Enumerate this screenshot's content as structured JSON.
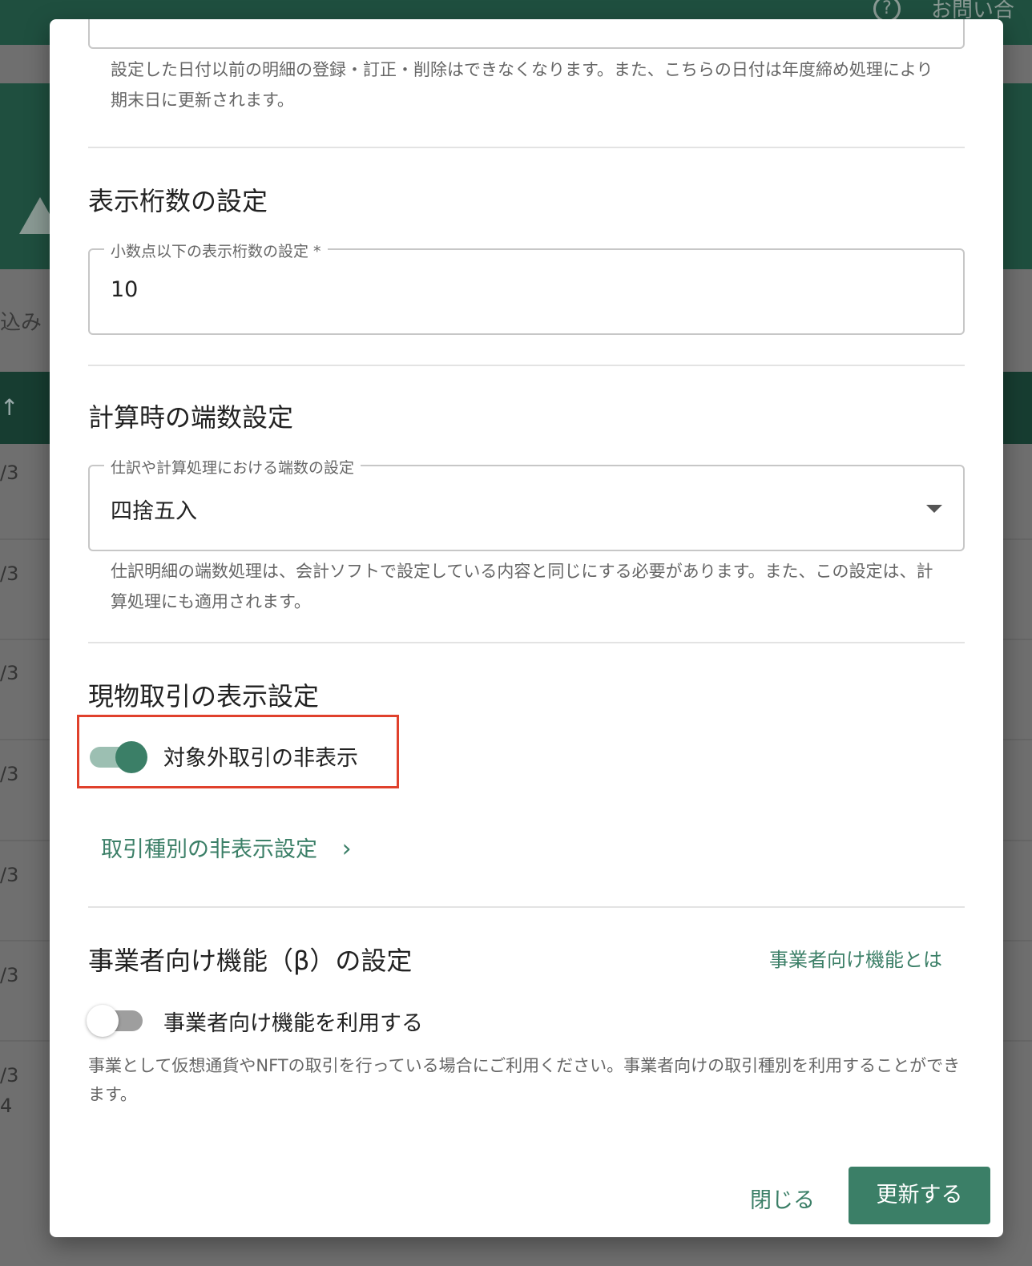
{
  "background": {
    "help_glyph": "?",
    "contact_label": "お問い合わ",
    "tab_label": "込み",
    "sort_arrow": "↑",
    "rows": [
      "/3",
      "/3",
      "/3",
      "/3",
      "/3",
      "/3",
      "/3",
      "4"
    ]
  },
  "modal": {
    "date_section": {
      "helper": "設定した日付以前の明細の登録・訂正・削除はできなくなります。また、こちらの日付は年度締め処理により期末日に更新されます。"
    },
    "decimal_section": {
      "heading": "表示桁数の設定",
      "field_label": "小数点以下の表示桁数の設定 *",
      "field_value": "10"
    },
    "rounding_section": {
      "heading": "計算時の端数設定",
      "field_label": "仕訳や計算処理における端数の設定",
      "selected_value": "四捨五入",
      "helper": "仕訳明細の端数処理は、会計ソフトで設定している内容と同じにする必要があります。また、この設定は、計算処理にも適用されます。"
    },
    "spot_section": {
      "heading": "現物取引の表示設定",
      "toggle_label": "対象外取引の非表示",
      "toggle_on": true,
      "link_label": "取引種別の非表示設定",
      "link_chevron": "›"
    },
    "business_section": {
      "heading": "事業者向け機能（β）の設定",
      "help_link": "事業者向け機能とは",
      "toggle_label": "事業者向け機能を利用する",
      "toggle_on": false,
      "helper": "事業として仮想通貨やNFTの取引を行っている場合にご利用ください。事業者向けの取引種別を利用することができます。"
    },
    "footer": {
      "close_label": "閉じる",
      "update_label": "更新する"
    },
    "colors": {
      "accent": "#3b7f67",
      "highlight": "#e0412c"
    }
  }
}
